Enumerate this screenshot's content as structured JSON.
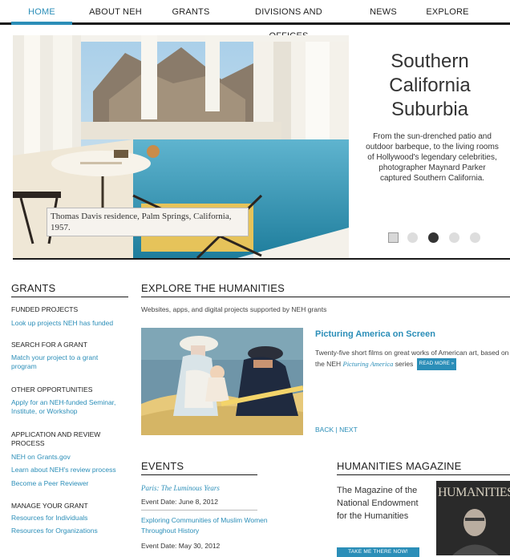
{
  "nav": {
    "items": [
      "HOME",
      "ABOUT NEH",
      "GRANTS",
      "DIVISIONS AND OFFICES",
      "NEWS",
      "EXPLORE"
    ]
  },
  "hero": {
    "title": "Southern California Suburbia",
    "description": "From the sun-drenched patio and outdoor barbeque, to the living rooms of Hollywood's legendary celebrities, photographer Maynard Parker captured Southern California.",
    "caption": "Thomas Davis residence, Palm Springs, California, 1957.",
    "slide_count": 5,
    "active_slide": 3
  },
  "grants": {
    "title": "GRANTS",
    "groups": [
      {
        "category": "FUNDED PROJECTS",
        "links": [
          "Look up projects NEH has funded"
        ]
      },
      {
        "category": "SEARCH FOR A GRANT",
        "links": [
          "Match your project to a grant program"
        ]
      },
      {
        "category": "OTHER OPPORTUNITIES",
        "links": [
          "Apply for an NEH-funded Seminar, Institute, or Workshop"
        ]
      },
      {
        "category": "APPLICATION AND REVIEW PROCESS",
        "links": [
          "NEH on Grants.gov",
          "Learn about NEH's review process",
          "Become a Peer Reviewer"
        ]
      },
      {
        "category": "MANAGE YOUR GRANT",
        "links": [
          "Resources for Individuals",
          "Resources for Organizations"
        ]
      }
    ]
  },
  "explore": {
    "title": "EXPLORE THE HUMANITIES",
    "subtitle": "Websites, apps, and digital projects supported by NEH grants",
    "feature_title": "Picturing America on Screen",
    "feature_desc_before": "Twenty-five short films on great works of American art, based on the NEH ",
    "feature_desc_italic": "Picturing America",
    "feature_desc_after": " series",
    "read_more": "READ MORE »",
    "back": "BACK",
    "sep": " | ",
    "next": "NEXT"
  },
  "events": {
    "title": "EVENTS",
    "items": [
      {
        "title": "Paris: The Luminous Years",
        "date": "Event Date: June 8, 2012"
      },
      {
        "title": "Exploring Communities of Muslim Women Throughout History",
        "date": "Event Date: May 30, 2012"
      }
    ]
  },
  "magazine": {
    "title": "HUMANITIES MAGAZINE",
    "text": "The Magazine of the National Endowment for the Humanities",
    "button": "TAKE ME THERE NOW!",
    "cover_title": "HUMANITIES"
  },
  "colors": {
    "accent": "#2b8eb8",
    "text": "#333333",
    "rule": "#1a1a1a"
  }
}
